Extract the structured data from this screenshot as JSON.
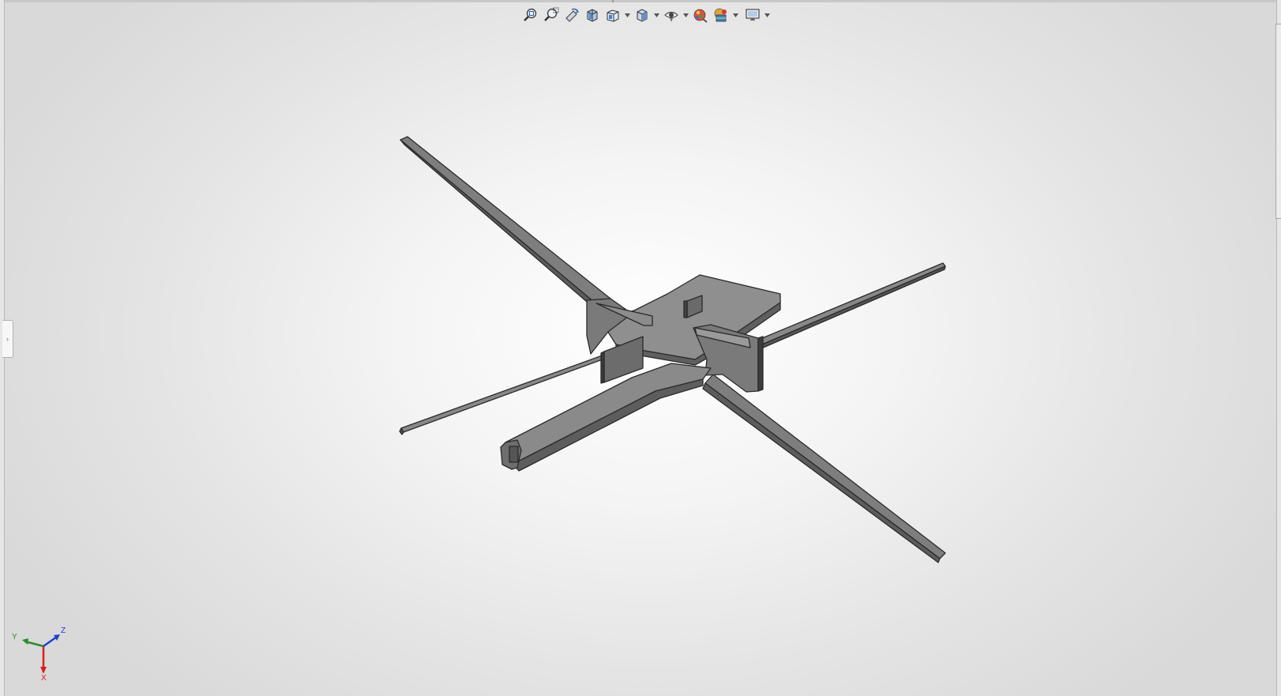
{
  "window": {
    "title": ""
  },
  "toolbar": {
    "buttons": [
      {
        "name": "zoom-to-fit-icon",
        "dropdown": false
      },
      {
        "name": "zoom-to-area-icon",
        "dropdown": false
      },
      {
        "name": "previous-view-icon",
        "dropdown": false
      },
      {
        "name": "section-view-icon",
        "dropdown": false
      },
      {
        "name": "view-orientation-icon",
        "dropdown": true
      },
      {
        "name": "display-style-icon",
        "dropdown": true
      },
      {
        "name": "hide-show-items-icon",
        "dropdown": true
      },
      {
        "name": "edit-appearance-icon",
        "dropdown": false
      },
      {
        "name": "apply-scene-icon",
        "dropdown": true
      },
      {
        "name": "view-settings-icon",
        "dropdown": true
      }
    ]
  },
  "triad": {
    "x_label": "X",
    "y_label": "Y",
    "z_label": "Z",
    "x_color": "#d42020",
    "y_color": "#2e8b2e",
    "z_color": "#1f3fd0"
  },
  "model": {
    "face_color": "#8a8a8a",
    "edge_color": "#2a2a2a"
  }
}
